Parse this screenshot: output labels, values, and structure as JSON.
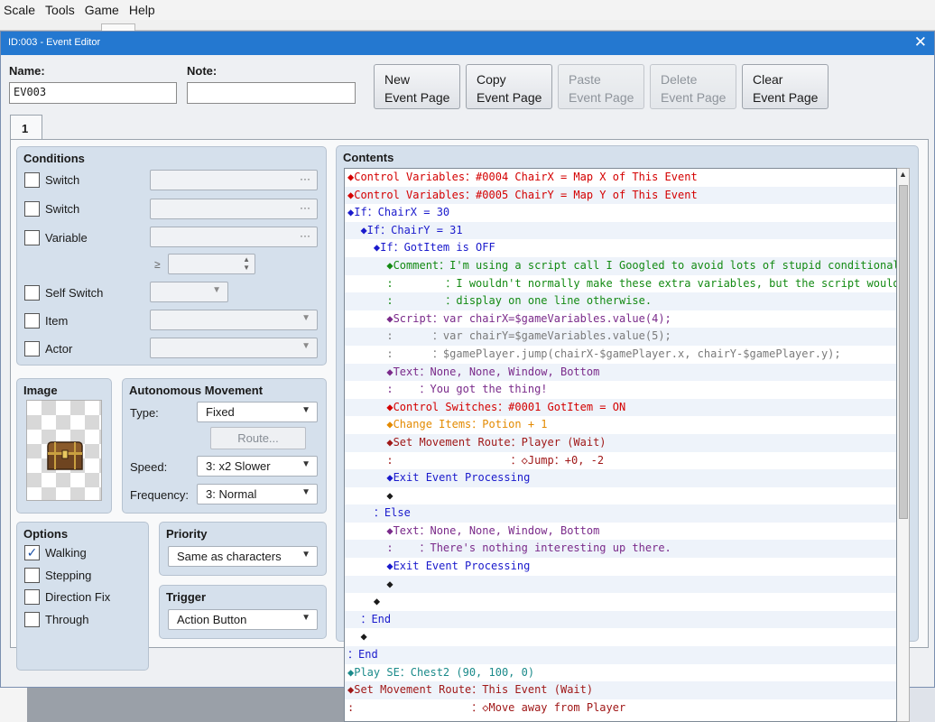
{
  "menu": [
    "Scale",
    "Tools",
    "Game",
    "Help"
  ],
  "dialog": {
    "title": "ID:003 - Event Editor",
    "close_glyph": "✕",
    "name_label": "Name:",
    "name_value": "EV003",
    "note_label": "Note:",
    "note_value": "",
    "buttons": {
      "new": [
        "New",
        "Event Page"
      ],
      "copy": [
        "Copy",
        "Event Page"
      ],
      "paste": [
        "Paste",
        "Event Page"
      ],
      "delete": [
        "Delete",
        "Event Page"
      ],
      "clear": [
        "Clear",
        "Event Page"
      ]
    },
    "tab_label": "1"
  },
  "conditions": {
    "title": "Conditions",
    "switch1": "Switch",
    "switch2": "Switch",
    "variable": "Variable",
    "ge_symbol": "≥",
    "self_switch": "Self Switch",
    "item": "Item",
    "actor": "Actor",
    "dots": "···"
  },
  "image": {
    "title": "Image",
    "icon": "treasure-chest-icon"
  },
  "movement": {
    "title": "Autonomous Movement",
    "type_label": "Type:",
    "type_value": "Fixed",
    "route_label": "Route...",
    "speed_label": "Speed:",
    "speed_value": "3: x2 Slower",
    "frequency_label": "Frequency:",
    "frequency_value": "3: Normal"
  },
  "options": {
    "title": "Options",
    "walking": "Walking",
    "stepping": "Stepping",
    "direction_fix": "Direction Fix",
    "through": "Through",
    "walking_checked": true,
    "check_glyph": "✓"
  },
  "priority": {
    "title": "Priority",
    "value": "Same as characters"
  },
  "trigger": {
    "title": "Trigger",
    "value": "Action Button"
  },
  "contents": {
    "title": "Contents",
    "rows": [
      "◆Control Variables：#0004 ChairX = Map X of This Event",
      "◆Control Variables：#0005 ChairY = Map Y of This Event",
      "◆If：ChairX = 30",
      "  ◆If：ChairY = 31",
      "    ◆If：GotItem is OFF",
      "      ◆Comment：I'm using a script call I Googled to avoid lots of stupid conditionals.",
      "      :        ：I wouldn't normally make these extra variables, but the script wouldn't",
      "      :        ：display on one line otherwise.",
      "      ◆Script：var chairX=$gameVariables.value(4);",
      "      :      ：var chairY=$gameVariables.value(5);",
      "      :      ：$gamePlayer.jump(chairX-$gamePlayer.x, chairY-$gamePlayer.y);",
      "      ◆Text：None, None, Window, Bottom",
      "      :    ：You got the thing!",
      "      ◆Control Switches：#0001 GotItem = ON",
      "      ◆Change Items：Potion + 1",
      "      ◆Set Movement Route：Player (Wait)",
      "      :                  ：◇Jump：+0, -2",
      "      ◆Exit Event Processing",
      "      ◆",
      "    ：Else",
      "      ◆Text：None, None, Window, Bottom",
      "      :    ：There's nothing interesting up there.",
      "      ◆Exit Event Processing",
      "      ◆",
      "    ◆",
      "  ：End",
      "  ◆",
      "：End",
      "◆Play SE：Chest2 (90, 100, 0)",
      "◆Set Movement Route：This Event (Wait)",
      ":                  ：◇Move away from Player"
    ]
  }
}
